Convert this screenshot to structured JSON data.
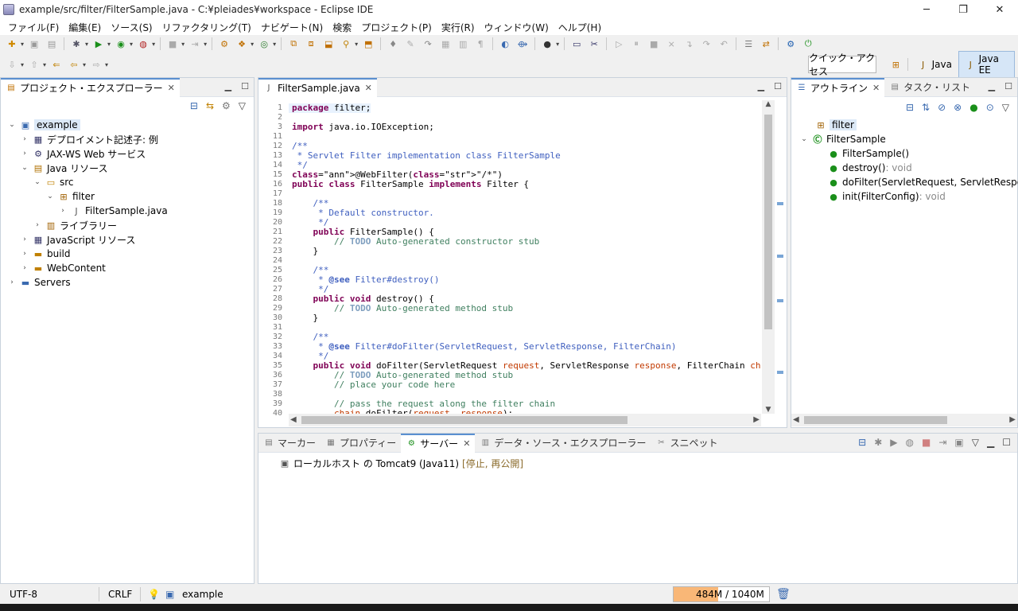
{
  "window": {
    "title": "example/src/filter/FilterSample.java - C:¥pleiades¥workspace - Eclipse IDE"
  },
  "menu": [
    "ファイル(F)",
    "編集(E)",
    "ソース(S)",
    "リファクタリング(T)",
    "ナビゲート(N)",
    "検索",
    "プロジェクト(P)",
    "実行(R)",
    "ウィンドウ(W)",
    "ヘルプ(H)"
  ],
  "quick_access": {
    "label": "クイック・アクセス"
  },
  "perspectives": [
    {
      "label": "Java"
    },
    {
      "label": "Java EE"
    }
  ],
  "explorer": {
    "tab": "プロジェクト・エクスプローラー",
    "items": [
      {
        "label": "example"
      },
      {
        "label": "デプロイメント記述子: 例"
      },
      {
        "label": "JAX-WS Web サービス"
      },
      {
        "label": "Java リソース"
      },
      {
        "label": "src"
      },
      {
        "label": "filter"
      },
      {
        "label": "FilterSample.java"
      },
      {
        "label": "ライブラリー"
      },
      {
        "label": "JavaScript リソース"
      },
      {
        "label": "build"
      },
      {
        "label": "WebContent"
      },
      {
        "label": "Servers"
      }
    ]
  },
  "editor": {
    "tab": "FilterSample.java",
    "line_numbers": [
      "1",
      "2",
      "3",
      "11",
      "12",
      "13",
      "14",
      "15",
      "16",
      "17",
      "18",
      "19",
      "20",
      "21",
      "22",
      "23",
      "24",
      "25",
      "26",
      "27",
      "28",
      "29",
      "30",
      "31",
      "32",
      "33",
      "34",
      "35",
      "36",
      "37",
      "38",
      "39",
      "40"
    ],
    "lines": [
      {
        "text": "package filter;"
      },
      {
        "text": ""
      },
      {
        "text": "import java.io.IOException;"
      },
      {
        "text": ""
      },
      {
        "text": "/**"
      },
      {
        "text": " * Servlet Filter implementation class FilterSample"
      },
      {
        "text": " */"
      },
      {
        "text": "@WebFilter(\"/*\")"
      },
      {
        "text": "public class FilterSample implements Filter {"
      },
      {
        "text": ""
      },
      {
        "text": "    /**"
      },
      {
        "text": "     * Default constructor."
      },
      {
        "text": "     */"
      },
      {
        "text": "    public FilterSample() {"
      },
      {
        "text": "        // TODO Auto-generated constructor stub"
      },
      {
        "text": "    }"
      },
      {
        "text": ""
      },
      {
        "text": "    /**"
      },
      {
        "text": "     * @see Filter#destroy()"
      },
      {
        "text": "     */"
      },
      {
        "text": "    public void destroy() {"
      },
      {
        "text": "        // TODO Auto-generated method stub"
      },
      {
        "text": "    }"
      },
      {
        "text": ""
      },
      {
        "text": "    /**"
      },
      {
        "text": "     * @see Filter#doFilter(ServletRequest, ServletResponse, FilterChain)"
      },
      {
        "text": "     */"
      },
      {
        "text": "    public void doFilter(ServletRequest request, ServletResponse response, FilterChain chain) thr"
      },
      {
        "text": "        // TODO Auto-generated method stub"
      },
      {
        "text": "        // place your code here"
      },
      {
        "text": ""
      },
      {
        "text": "        // pass the request along the filter chain"
      },
      {
        "text": "        chain.doFilter(request, response);"
      }
    ]
  },
  "outline": {
    "tab": "アウトライン",
    "tab2": "タスク・リスト",
    "items": [
      {
        "label": "filter"
      },
      {
        "label": "FilterSample"
      },
      {
        "label": "FilterSample()"
      },
      {
        "label": "destroy()",
        "ret": " : void"
      },
      {
        "label": "doFilter(ServletRequest, ServletResponse"
      },
      {
        "label": "init(FilterConfig)",
        "ret": " : void"
      }
    ]
  },
  "bottom": {
    "tabs": [
      {
        "label": "マーカー"
      },
      {
        "label": "プロパティー"
      },
      {
        "label": "サーバー"
      },
      {
        "label": "データ・ソース・エクスプローラー"
      },
      {
        "label": "スニペット"
      }
    ],
    "server": {
      "label": "ローカルホスト の Tomcat9 (Java11)",
      "status": "[停止, 再公開]"
    }
  },
  "status": {
    "encoding": "UTF-8",
    "line_ending": "CRLF",
    "project": "example",
    "heap": "484M / 1040M",
    "heap_used_fraction": 0.465
  }
}
